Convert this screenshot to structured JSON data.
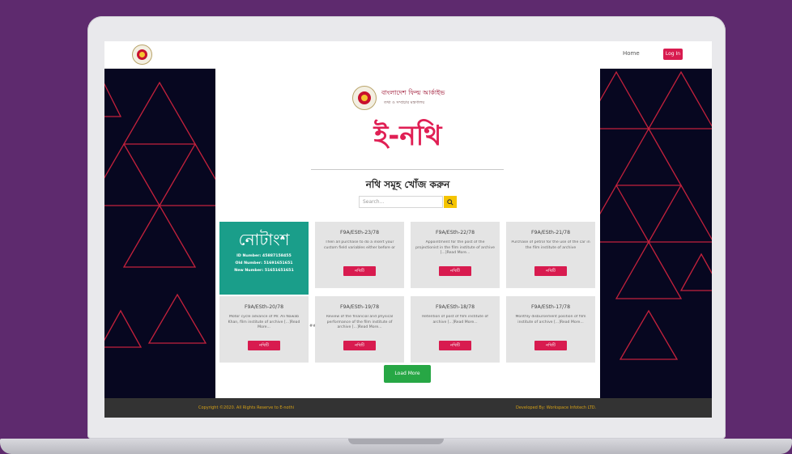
{
  "navbar": {
    "home_label": "Home",
    "login_label": "Log In"
  },
  "brand": {
    "name": "বাংলাদেশ ফিল্ম আর্কাইভ",
    "sub": "তথ্য ও সম্প্রচার মন্ত্রণালয়"
  },
  "hero": {
    "title": "ই-নথি"
  },
  "search": {
    "heading": "নথি সমূহ খোঁজ করুন",
    "placeholder": "Search..."
  },
  "note_card": {
    "title": "নোটাংশ",
    "id_line": "ID Number: 45887158455",
    "old_line": "Old Number: 51691651651",
    "new_line": "New Number: 51651651651"
  },
  "cards": [
    {
      "title": "F9A/ESth-23/78",
      "desc": "Then all purchase to do a insert your custom field variables either before or"
    },
    {
      "title": "F9A/ESth-22/78",
      "desc": "Appointment for the post of the projectionist in the film institute of archive [...]Read More..."
    },
    {
      "title": "F9A/ESth-21/78",
      "desc": "Purchase of petrol for the use of the car in the film institute of archive"
    },
    {
      "title": "F9A/ESth-20/78",
      "desc": "Motor cycle advance of Mr. Ali Nawab Khan, film institute of archive [...]Read More..."
    },
    {
      "title": "F9A/ESth-19/78",
      "desc": "Review of the financial and physical performance of the film institute of archive [...]Read More..."
    },
    {
      "title": "F9A/ESth-18/78",
      "desc": "Retention of post of film institute of archive [...]Read More..."
    },
    {
      "title": "F9A/ESth-17/78",
      "desc": "Monthly disbursement position of film institute of archive [...]Read More..."
    }
  ],
  "card_button_label": "নথিটি",
  "stray_text": "##",
  "load_more_label": "Load More",
  "footer": {
    "copyright": "Copyright ©2020. All Rights Reserve to E-nothi",
    "developer": "Developed By: Workspace Infotech LTD."
  },
  "colors": {
    "accent": "#e01f54",
    "button": "#d81b4f",
    "note_card": "#1a9e8a",
    "load_more": "#27a745",
    "search_button": "#f5c400",
    "page_background": "#5e2a6e"
  }
}
